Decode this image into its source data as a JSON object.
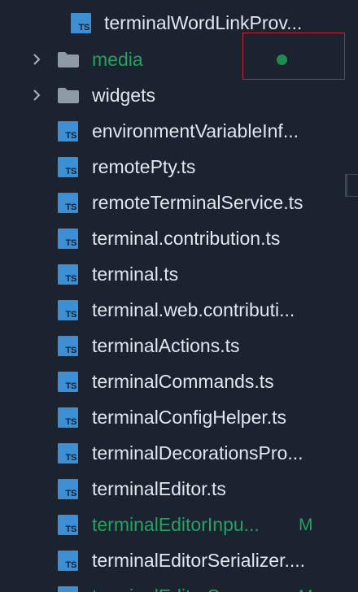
{
  "explorer": {
    "file_icon_label": "TS",
    "git_modified_color": "#23a35e",
    "ts_icon_color": "#3c8fd4",
    "top_item": {
      "label": "terminalWordLinkProv...",
      "icon": "ts-file-icon"
    },
    "folders": [
      {
        "label": "media",
        "icon": "folder-icon",
        "status": "modified-dot"
      },
      {
        "label": "widgets",
        "icon": "folder-icon"
      }
    ],
    "files": [
      {
        "label": "environmentVariableInf..."
      },
      {
        "label": "remotePty.ts"
      },
      {
        "label": "remoteTerminalService.ts"
      },
      {
        "label": "terminal.contribution.ts"
      },
      {
        "label": "terminal.ts"
      },
      {
        "label": "terminal.web.contributi..."
      },
      {
        "label": "terminalActions.ts"
      },
      {
        "label": "terminalCommands.ts"
      },
      {
        "label": "terminalConfigHelper.ts"
      },
      {
        "label": "terminalDecorationsPro..."
      },
      {
        "label": "terminalEditor.ts"
      },
      {
        "label": "terminalEditorInpu...",
        "badge": "M"
      },
      {
        "label": "terminalEditorSerializer...."
      },
      {
        "label": "terminalEditorSe...",
        "badge": "M"
      }
    ]
  }
}
